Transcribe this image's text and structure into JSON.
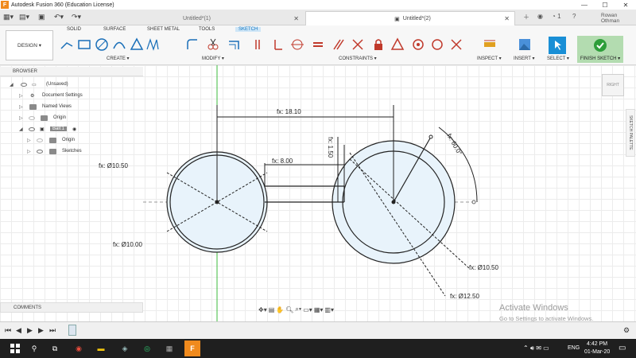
{
  "window": {
    "title": "Autodesk Fusion 360 (Education License)",
    "logo": "F"
  },
  "tabs": [
    {
      "label": "Untitled*(1)"
    },
    {
      "label": "Untitled*(2)"
    }
  ],
  "header": {
    "job_count": "1",
    "user": "Rowan Othman"
  },
  "toolbar": {
    "workspace": "DESIGN ▾",
    "tabs": [
      "SOLID",
      "SURFACE",
      "SHEET METAL",
      "TOOLS",
      "SKETCH"
    ],
    "groups": {
      "create": "CREATE ▾",
      "modify": "MODIFY ▾",
      "constraints": "CONSTRAINTS ▾",
      "inspect": "INSPECT ▾",
      "insert": "INSERT ▾",
      "select": "SELECT ▾",
      "finish": "FINISH SKETCH ▾"
    }
  },
  "browser": {
    "title": "BROWSER",
    "items": [
      {
        "label": "(Unsaved)"
      },
      {
        "label": "Document Settings"
      },
      {
        "label": "Named Views"
      },
      {
        "label": "Origin"
      },
      {
        "label": "Ball:1"
      },
      {
        "label": "Origin"
      },
      {
        "label": "Sketches"
      }
    ]
  },
  "comments": {
    "label": "COMMENTS"
  },
  "viewcube": {
    "label": "RIGHT"
  },
  "sketch_palette": {
    "label": "SKETCH PALETTE"
  },
  "sketch": {
    "dimensions": {
      "d1": "fx: 18.10",
      "d2": "fx: 8.00",
      "d3": "fx: 1.50",
      "d4": "fx: 60.0°",
      "d5": "fx: Ø10.50",
      "d6": "fx: Ø10.00",
      "d7": "fx: Ø10.50",
      "d8": "fx: Ø12.50"
    }
  },
  "watermark": {
    "line1": "Activate Windows",
    "line2": "Go to Settings to activate Windows."
  },
  "taskbar": {
    "lang": "ENG",
    "time": "4:42 PM",
    "date": "01-Mar-20"
  },
  "colors": {
    "accent": "#1477c0",
    "finish": "#b3dcb0",
    "taskbar": "#1f1f1f",
    "fusion_orange": "#f08a1d"
  }
}
